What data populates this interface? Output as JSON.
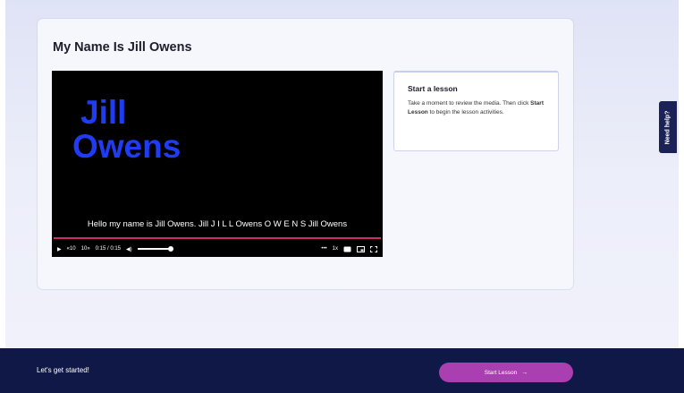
{
  "page": {
    "title": "My Name Is Jill Owens"
  },
  "video": {
    "slide_line1": "Jill",
    "slide_line2": "Owens",
    "caption": "Hello my name is Jill Owens. Jill J I L L Owens O W E N S Jill Owens",
    "controls": {
      "play": "▶",
      "rewind": "«10",
      "forward": "10»",
      "time": "0:15 / 0:15",
      "volume": "◀)",
      "more": "•••",
      "speed": "1x"
    },
    "progress_fraction": 1.0,
    "volume_fraction": 1.0
  },
  "lesson": {
    "title": "Start a lesson",
    "desc_before": "Take a moment to review the media. Then click ",
    "desc_bold": "Start Lesson",
    "desc_after": " to begin the lesson activities."
  },
  "help": {
    "label": "Need help?"
  },
  "footer": {
    "text": "Let's get started!",
    "button_label": "Start Lesson",
    "button_arrow": "→"
  },
  "colors": {
    "footer_bg": "#0f1846",
    "accent_button": "#a93fb0",
    "progress_bar": "#d0286f",
    "slide_text": "#1f3cf2",
    "help_tab": "#1a2257"
  }
}
